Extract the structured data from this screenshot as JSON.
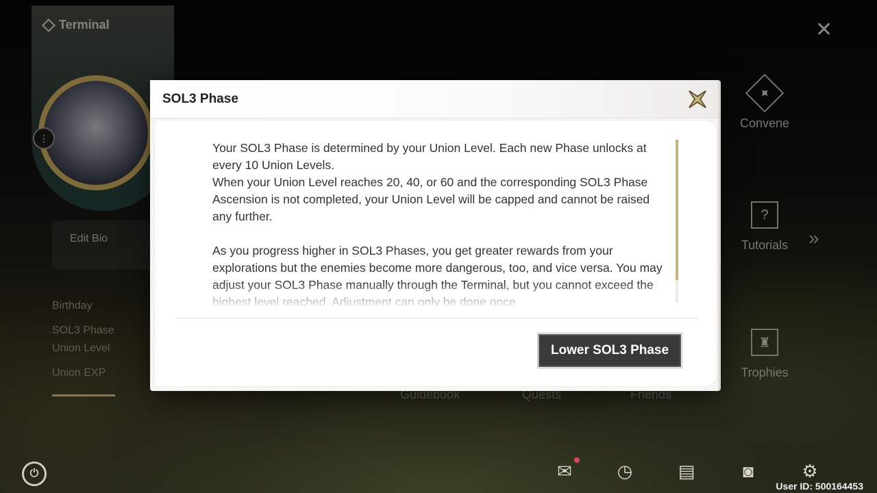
{
  "app": {
    "terminal_title": "Terminal"
  },
  "profile": {
    "edit_bio": "Edit Bio",
    "info_rows": [
      "Birthday",
      "SOL3 Phase",
      "Union Level",
      "Union EXP"
    ]
  },
  "nav": {
    "convene": "Convene",
    "tutorials": "Tutorials",
    "trophies": "Trophies",
    "guidebook": "Guidebook",
    "quests": "Quests",
    "friends": "Friends"
  },
  "footer": {
    "user_id": "User ID: 500164453"
  },
  "dialog": {
    "title": "SOL3 Phase",
    "paragraph_1": "Your SOL3 Phase is determined by your Union Level. Each new Phase unlocks at every 10 Union Levels.",
    "paragraph_2": "When your Union Level reaches 20, 40, or 60 and the corresponding SOL3 Phase Ascension is not completed, your Union Level will be capped and cannot be raised any further.",
    "paragraph_3": "As you progress higher in SOL3 Phases, you get greater rewards from your explorations but the enemies become more dangerous, too, and vice versa. You may adjust your SOL3 Phase manually through the Terminal, but you cannot exceed the highest level reached. Adjustment can only be done once",
    "action_button": "Lower SOL3 Phase"
  },
  "colors": {
    "accent_gold": "#c7b27a",
    "button_dark": "#3a3a38",
    "dialog_bg": "#ffffff"
  },
  "icons": {
    "close": "close-x-icon",
    "convene": "convene-icon",
    "tutorials": "tutorials-icon",
    "trophies": "trophy-icon",
    "power": "power-icon",
    "mail": "mail-icon",
    "clock": "clock-icon",
    "notes": "notes-icon",
    "camera": "camera-icon",
    "settings": "settings-icon"
  }
}
